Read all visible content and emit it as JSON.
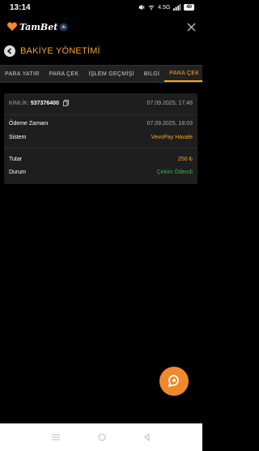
{
  "status_bar": {
    "time": "13:14",
    "network": "4.5G",
    "battery": "40"
  },
  "app": {
    "logo_text": "TamBet",
    "close_icon": "close-icon"
  },
  "page": {
    "title": "BAKİYE YÖNETİMİ"
  },
  "tabs": [
    {
      "label": "PARA YATIR",
      "active": false
    },
    {
      "label": "PARA ÇEK",
      "active": false
    },
    {
      "label": "İŞLEM GEÇMİŞİ",
      "active": false
    },
    {
      "label": "BİLGİ",
      "active": false
    },
    {
      "label": "PARA ÇEK",
      "active": true
    }
  ],
  "transaction": {
    "id_label": "KİMLİK:",
    "id_value": "537376400",
    "created_at": "07.09.2025, 17:48",
    "payment_time_label": "Ödeme Zamanı",
    "payment_time_value": "07.09.2025, 18:03",
    "system_label": "Sistem",
    "system_value": "VevoPay Havale",
    "amount_label": "Tutar",
    "amount_value": "250 ₺",
    "status_label": "Durum",
    "status_value": "Çekim Ödendi"
  },
  "colors": {
    "accent": "#f5a623",
    "success": "#33b24a",
    "fab": "#f0892b",
    "card_bg": "#1e1e1e"
  },
  "icons": {
    "fab": "chat-bubble-icon",
    "back": "back-arrow-icon",
    "copy": "copy-icon"
  }
}
